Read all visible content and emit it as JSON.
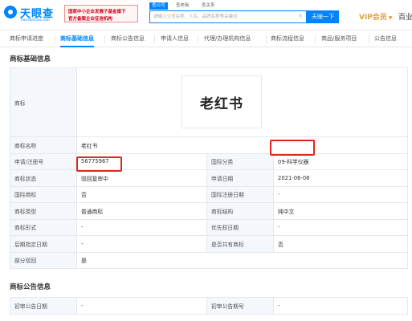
{
  "header": {
    "logo_title": "天眼查",
    "logo_sub": "TianYanCha.com",
    "banner_line1": "国家中小企业发展子基金旗下",
    "banner_line2": "官方备案企业征信机构",
    "search_tabs": [
      "查公司",
      "查老板",
      "查关系"
    ],
    "search_placeholder": "请输入公司名称、人名、品牌名称等关键词",
    "search_button": "天眼一下",
    "vip_label": "VIP会员",
    "merchant_label": "百业"
  },
  "tabs": [
    "商标申请进度",
    "商标基础信息",
    "商标公告信息",
    "申请人信息",
    "代理/办理机构信息",
    "商标流程信息",
    "商品/服务项目",
    "公告信息"
  ],
  "active_tab": "商标基础信息",
  "basic": {
    "section_title": "商标基础信息",
    "logo_label": "商标",
    "trademark_text": "老红书",
    "rows": [
      [
        {
          "k": "商标名称",
          "v": "老红书"
        }
      ],
      [
        {
          "k": "申请/注册号",
          "v": "56775967"
        },
        {
          "k": "国际分类",
          "v": "09-科学仪器"
        }
      ],
      [
        {
          "k": "商标状态",
          "v": "驳回复审中"
        },
        {
          "k": "申请日期",
          "v": "2021-06-08"
        }
      ],
      [
        {
          "k": "国际商标",
          "v": "否"
        },
        {
          "k": "国际注册日期",
          "v": "-"
        }
      ],
      [
        {
          "k": "商标类型",
          "v": "普通商标"
        },
        {
          "k": "商标结构",
          "v": "纯中文"
        }
      ],
      [
        {
          "k": "商标形式",
          "v": "-"
        },
        {
          "k": "优先权日期",
          "v": "-"
        }
      ],
      [
        {
          "k": "后期指定日期",
          "v": "-"
        },
        {
          "k": "是否共有商标",
          "v": "否"
        }
      ],
      [
        {
          "k": "部分驳回",
          "v": "是"
        }
      ]
    ]
  },
  "announcement": {
    "section_title": "商标公告信息",
    "rows": [
      [
        {
          "k": "初审公告日期",
          "v": "-"
        },
        {
          "k": "初审公告期号",
          "v": "-"
        }
      ]
    ]
  },
  "colors": {
    "accent": "#0084ff",
    "highlight": "#e3261c",
    "vip": "#e2a03b"
  }
}
